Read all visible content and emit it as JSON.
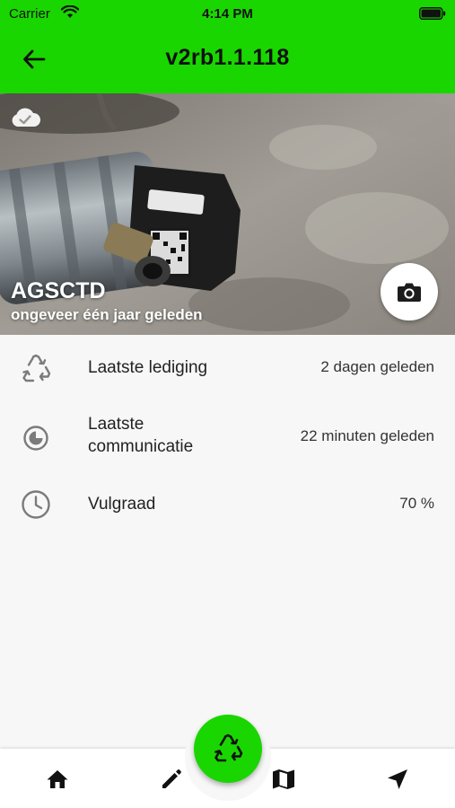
{
  "status_bar": {
    "carrier": "Carrier",
    "time": "4:14 PM"
  },
  "app_bar": {
    "title": "v2rb1.1.118",
    "back_icon": "arrow-left-icon",
    "background_color": "#19d600"
  },
  "hero": {
    "title": "AGSCTD",
    "subtitle": "ongeveer één jaar geleden",
    "sync_icon": "cloud-check-icon",
    "camera_icon": "camera-icon"
  },
  "info": [
    {
      "icon": "recycle-icon",
      "label": "Laatste lediging",
      "value": "2 dagen geleden"
    },
    {
      "icon": "pie-clock-icon",
      "label": "Laatste\ncommunicatie",
      "value": "22 minuten geleden"
    },
    {
      "icon": "clock-icon",
      "label": "Vulgraad",
      "value": "70 %"
    }
  ],
  "bottom_nav": {
    "items": [
      "home-icon",
      "pencil-icon",
      "map-icon",
      "navigation-icon"
    ],
    "fab_icon": "recycle-icon",
    "accent_color": "#19d600"
  }
}
